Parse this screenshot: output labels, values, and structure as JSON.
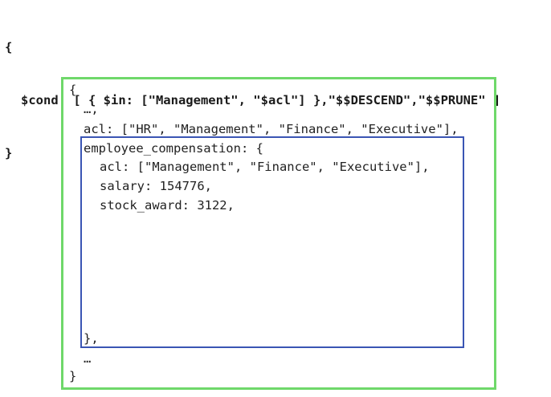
{
  "query": {
    "open_brace": "{",
    "cond_line": "$cond: [ { $in: [\"Management\", \"$acl\"] },\"$$DESCEND\",\"$$PRUNE\" ]",
    "close_brace": "}"
  },
  "document": {
    "open_brace": "{",
    "ellipsis_top": "…,",
    "acl_line": "acl: [\"HR\", \"Management\", \"Finance\", \"Executive\"],",
    "subdoc": {
      "key_line": "employee_compensation: {",
      "acl_line": "acl: [\"Management\", \"Finance\", \"Executive\"],",
      "salary_line": "salary: 154776,",
      "stock_line": "stock_award: 3122,",
      "close_line": "},"
    },
    "ellipsis_bottom": "…",
    "close_brace": "}"
  },
  "colors": {
    "outer_box_border": "#6fd86a",
    "inner_box_border": "#3a55b4",
    "text": "#222222"
  }
}
